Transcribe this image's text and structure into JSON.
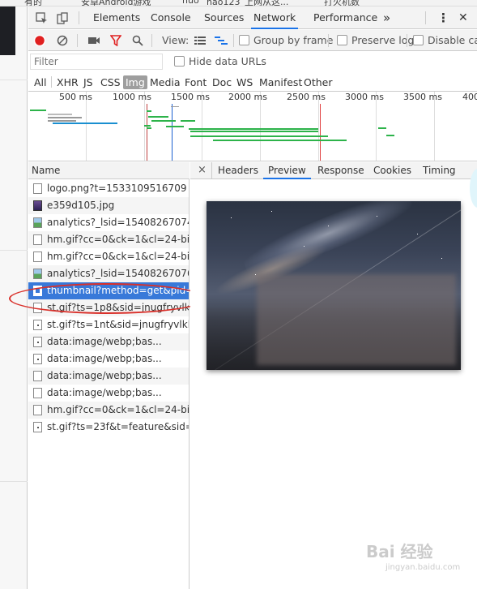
{
  "bookmarks": [
    "有的",
    "安卓Android游戏",
    "nuo",
    "hao123_上网从这...",
    "打火机数"
  ],
  "devtools": {
    "tabs": [
      {
        "label": "Elements",
        "active": false
      },
      {
        "label": "Console",
        "active": false
      },
      {
        "label": "Sources",
        "active": false
      },
      {
        "label": "Network",
        "active": true
      },
      {
        "label": "Performance",
        "active": false
      }
    ],
    "more_tabs": "»",
    "menu_icon": "⋮",
    "close_icon": "✕"
  },
  "toolbar": {
    "view_label": "View:",
    "group_by_frame": {
      "label": "Group by frame",
      "checked": false
    },
    "preserve_log": {
      "label": "Preserve log",
      "checked": false
    },
    "disable_cache": {
      "label": "Disable cac",
      "checked": false
    }
  },
  "filter": {
    "placeholder": "Filter",
    "hide_data_urls": {
      "label": "Hide data URLs",
      "checked": false
    }
  },
  "types": [
    {
      "label": "All",
      "active": false
    },
    {
      "label": "XHR",
      "active": false
    },
    {
      "label": "JS",
      "active": false
    },
    {
      "label": "CSS",
      "active": false
    },
    {
      "label": "Img",
      "active": true
    },
    {
      "label": "Media",
      "active": false
    },
    {
      "label": "Font",
      "active": false
    },
    {
      "label": "Doc",
      "active": false
    },
    {
      "label": "WS",
      "active": false
    },
    {
      "label": "Manifest",
      "active": false
    },
    {
      "label": "Other",
      "active": false
    }
  ],
  "overview": {
    "ticks": [
      "500 ms",
      "1000 ms",
      "1500 ms",
      "2000 ms",
      "2500 ms",
      "3000 ms",
      "3500 ms",
      "400"
    ]
  },
  "requests": {
    "header": "Name",
    "items": [
      {
        "name": "logo.png?t=1533109516709",
        "icon": "file"
      },
      {
        "name": "e359d105.jpg",
        "icon": "thumb"
      },
      {
        "name": "analytics?_lsid=154082670742...",
        "icon": "landscape"
      },
      {
        "name": "hm.gif?cc=0&ck=1&cl=24-bit...",
        "icon": "file"
      },
      {
        "name": "hm.gif?cc=0&ck=1&cl=24-bit...",
        "icon": "file"
      },
      {
        "name": "analytics?_lsid=154082670766...",
        "icon": "landscape"
      },
      {
        "name": "thumbnail?method=get&pid=...",
        "icon": "file",
        "selected": true
      },
      {
        "name": "st.gif?ts=1p8&sid=jnugfryvlkk...",
        "icon": "file"
      },
      {
        "name": "st.gif?ts=1nt&sid=jnugfryvlkk...",
        "icon": "dot"
      },
      {
        "name": "data:image/webp;bas...",
        "icon": "dot"
      },
      {
        "name": "data:image/webp;bas...",
        "icon": "dot"
      },
      {
        "name": "data:image/webp;bas...",
        "icon": "file"
      },
      {
        "name": "data:image/webp;bas...",
        "icon": "file"
      },
      {
        "name": "hm.gif?cc=0&ck=1&cl=24-bit...",
        "icon": "file"
      },
      {
        "name": "st.gif?ts=23f&t=feature&sid=j...",
        "icon": "dot"
      }
    ]
  },
  "detail": {
    "close": "×",
    "tabs": [
      {
        "label": "Headers",
        "active": false
      },
      {
        "label": "Preview",
        "active": true
      },
      {
        "label": "Response",
        "active": false
      },
      {
        "label": "Cookies",
        "active": false
      },
      {
        "label": "Timing",
        "active": false
      }
    ]
  },
  "watermark": {
    "main": "Bai 经验",
    "sub": "jingyan.baidu.com"
  },
  "colors": {
    "accent": "#1a73e8",
    "record": "#e02020",
    "selected_row": "#3879d9",
    "annotation": "#d9302a"
  }
}
